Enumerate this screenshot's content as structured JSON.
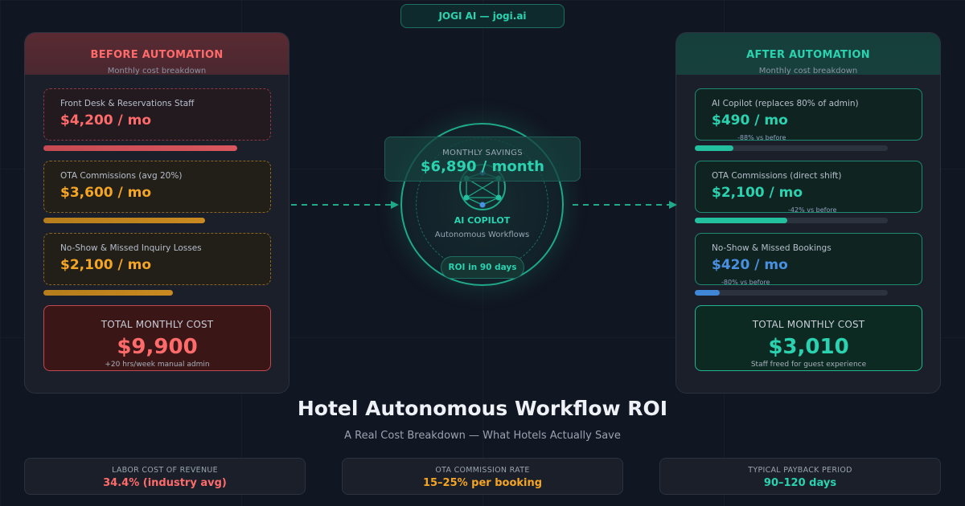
{
  "brand": "JOGI AI — jogi.ai",
  "before": {
    "title": "BEFORE AUTOMATION",
    "subtitle": "Monthly cost breakdown",
    "items": [
      {
        "label": "Front Desk & Reservations Staff",
        "value": "$4,200 / mo",
        "color": "#ff6b6b",
        "bar_fraction": 0.85
      },
      {
        "label": "OTA Commissions (avg 20%)",
        "value": "$3,600 / mo",
        "color": "#f5a524",
        "bar_fraction": 0.71
      },
      {
        "label": "No-Show & Missed Inquiry Losses",
        "value": "$2,100 / mo",
        "color": "#f5a524",
        "bar_fraction": 0.57
      }
    ],
    "total": {
      "label": "TOTAL MONTHLY COST",
      "value": "$9,900",
      "note": "+20 hrs/week manual admin"
    }
  },
  "after": {
    "title": "AFTER AUTOMATION",
    "subtitle": "Monthly cost breakdown",
    "items": [
      {
        "label": "AI Copilot (replaces 80% of admin)",
        "value": "$490 / mo",
        "color": "#2ad2b0",
        "note": "-88% vs before",
        "bar_fraction": 0.2
      },
      {
        "label": "OTA Commissions (direct shift)",
        "value": "$2,100 / mo",
        "color": "#2ad2b0",
        "note": "-42% vs before",
        "bar_fraction": 0.48
      },
      {
        "label": "No-Show & Missed Bookings",
        "value": "$420 / mo",
        "color": "#4a90e2",
        "note": "-80% vs before",
        "bar_fraction": 0.13
      }
    ],
    "total": {
      "label": "TOTAL MONTHLY COST",
      "value": "$3,010",
      "note": "Staff freed for guest experience"
    }
  },
  "center": {
    "savings_label": "MONTHLY SAVINGS",
    "savings_value": "$6,890 / month",
    "title": "AI COPILOT",
    "subtitle": "Autonomous Workflows",
    "roi": "ROI in 90 days"
  },
  "main": {
    "title": "Hotel Autonomous Workflow ROI",
    "subtitle": "A Real Cost Breakdown — What Hotels Actually Save"
  },
  "stats": [
    {
      "label": "LABOR COST OF REVENUE",
      "value": "34.4% (industry avg)",
      "color": "#ff6b6b"
    },
    {
      "label": "OTA COMMISSION RATE",
      "value": "15–25% per booking",
      "color": "#f5a524"
    },
    {
      "label": "TYPICAL PAYBACK PERIOD",
      "value": "90–120 days",
      "color": "#2ad2b0"
    }
  ],
  "icons": {
    "hub": "network-nodes-icon",
    "arrows": "dashed-arrow-icon"
  }
}
